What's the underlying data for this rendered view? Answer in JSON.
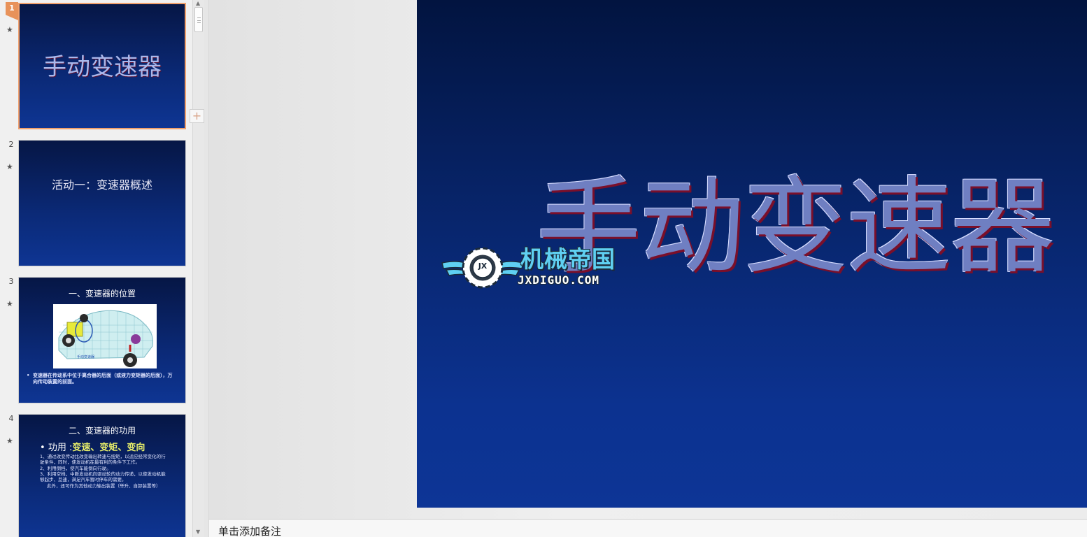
{
  "thumbnails": [
    {
      "number": "1",
      "title": "手动变速器"
    },
    {
      "number": "2",
      "title": "活动一：变速器概述"
    },
    {
      "number": "3",
      "heading": "一、变速器的位置",
      "image_label": "手动变速器",
      "caption": "变速器在传动系中位于离合器的后面（或液力变矩器的后面），万向传动装置的前面。"
    },
    {
      "number": "4",
      "heading": "二、变速器的功用",
      "bullet_prefix": "功用 :",
      "bullet_highlight": "变速、变矩、变向",
      "lines": [
        "1、通过改变传动比改变输出转速与扭矩，以适应经常变化的行驶条件，同时，使发动机在最有利的条件下工作。",
        "2、利用倒档，使汽车能倒向行驶。",
        "3、利用空档，中断发动机向驱动轮的动力传递，以使发动机能够起步、怠速，满足汽车暂时停车的需要。",
        "此外，还可作为其他动力输出装置（举升、自卸装置等）"
      ]
    }
  ],
  "slide_star": "★",
  "main_slide": {
    "title": "手动变速器"
  },
  "watermark": {
    "cn": "机械帝国",
    "en": "JXDIGUO.COM",
    "badge": "JX"
  },
  "notes": {
    "placeholder": "单击添加备注"
  },
  "scroll": {
    "up": "▲",
    "down": "▼",
    "add": "+"
  },
  "colors": {
    "accent": "#e8925a",
    "slide_top": "#021440",
    "slide_bottom": "#0d3596"
  },
  "icons": {
    "star": "star-icon",
    "add": "plus-icon",
    "gear": "gear-icon"
  }
}
